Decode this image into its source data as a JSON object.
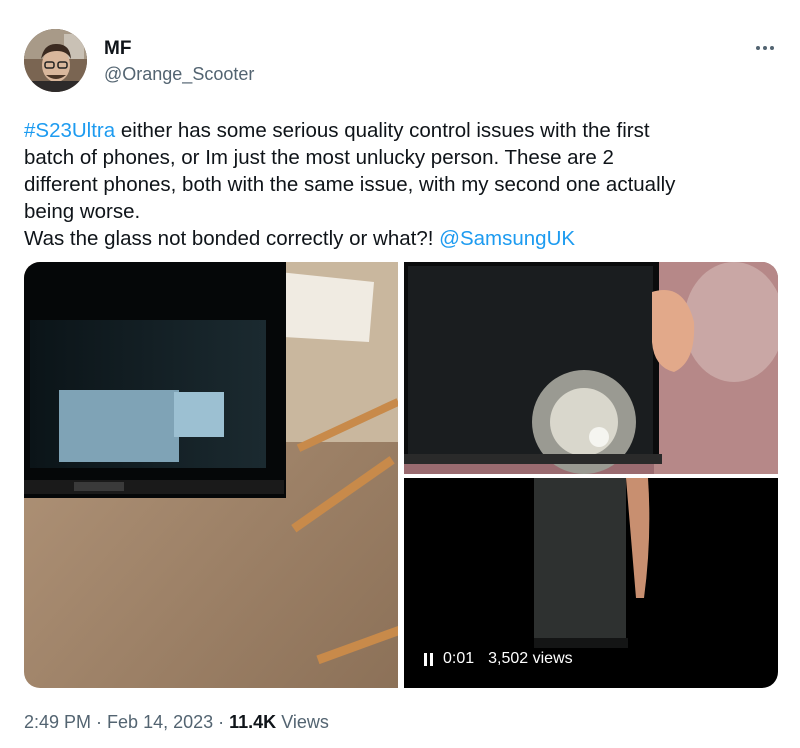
{
  "author": {
    "name": "MF",
    "handle": "@Orange_Scooter"
  },
  "tweet": {
    "hashtag": "#S23Ultra",
    "line1_rest": " either has some serious quality control issues with the first",
    "line2": "batch of phones, or Im just the most unlucky person. These are 2",
    "line3": "different phones, both with the same issue, with my second one actually",
    "line4": "being worse.",
    "line5_pre": "Was the glass not bonded correctly or what?! ",
    "mention": "@SamsungUK"
  },
  "video": {
    "time": "0:01",
    "views": "3,502 views"
  },
  "meta": {
    "time": "2:49 PM",
    "separator1": " · ",
    "date": "Feb 14, 2023",
    "separator2": " · ",
    "views_count": "11.4K",
    "views_label": " Views"
  },
  "icons": {
    "more": "more-dots-icon",
    "pause": "pause-icon"
  },
  "colors": {
    "link": "#1d9bf0",
    "secondary_text": "#536471",
    "primary_text": "#0f1419"
  }
}
